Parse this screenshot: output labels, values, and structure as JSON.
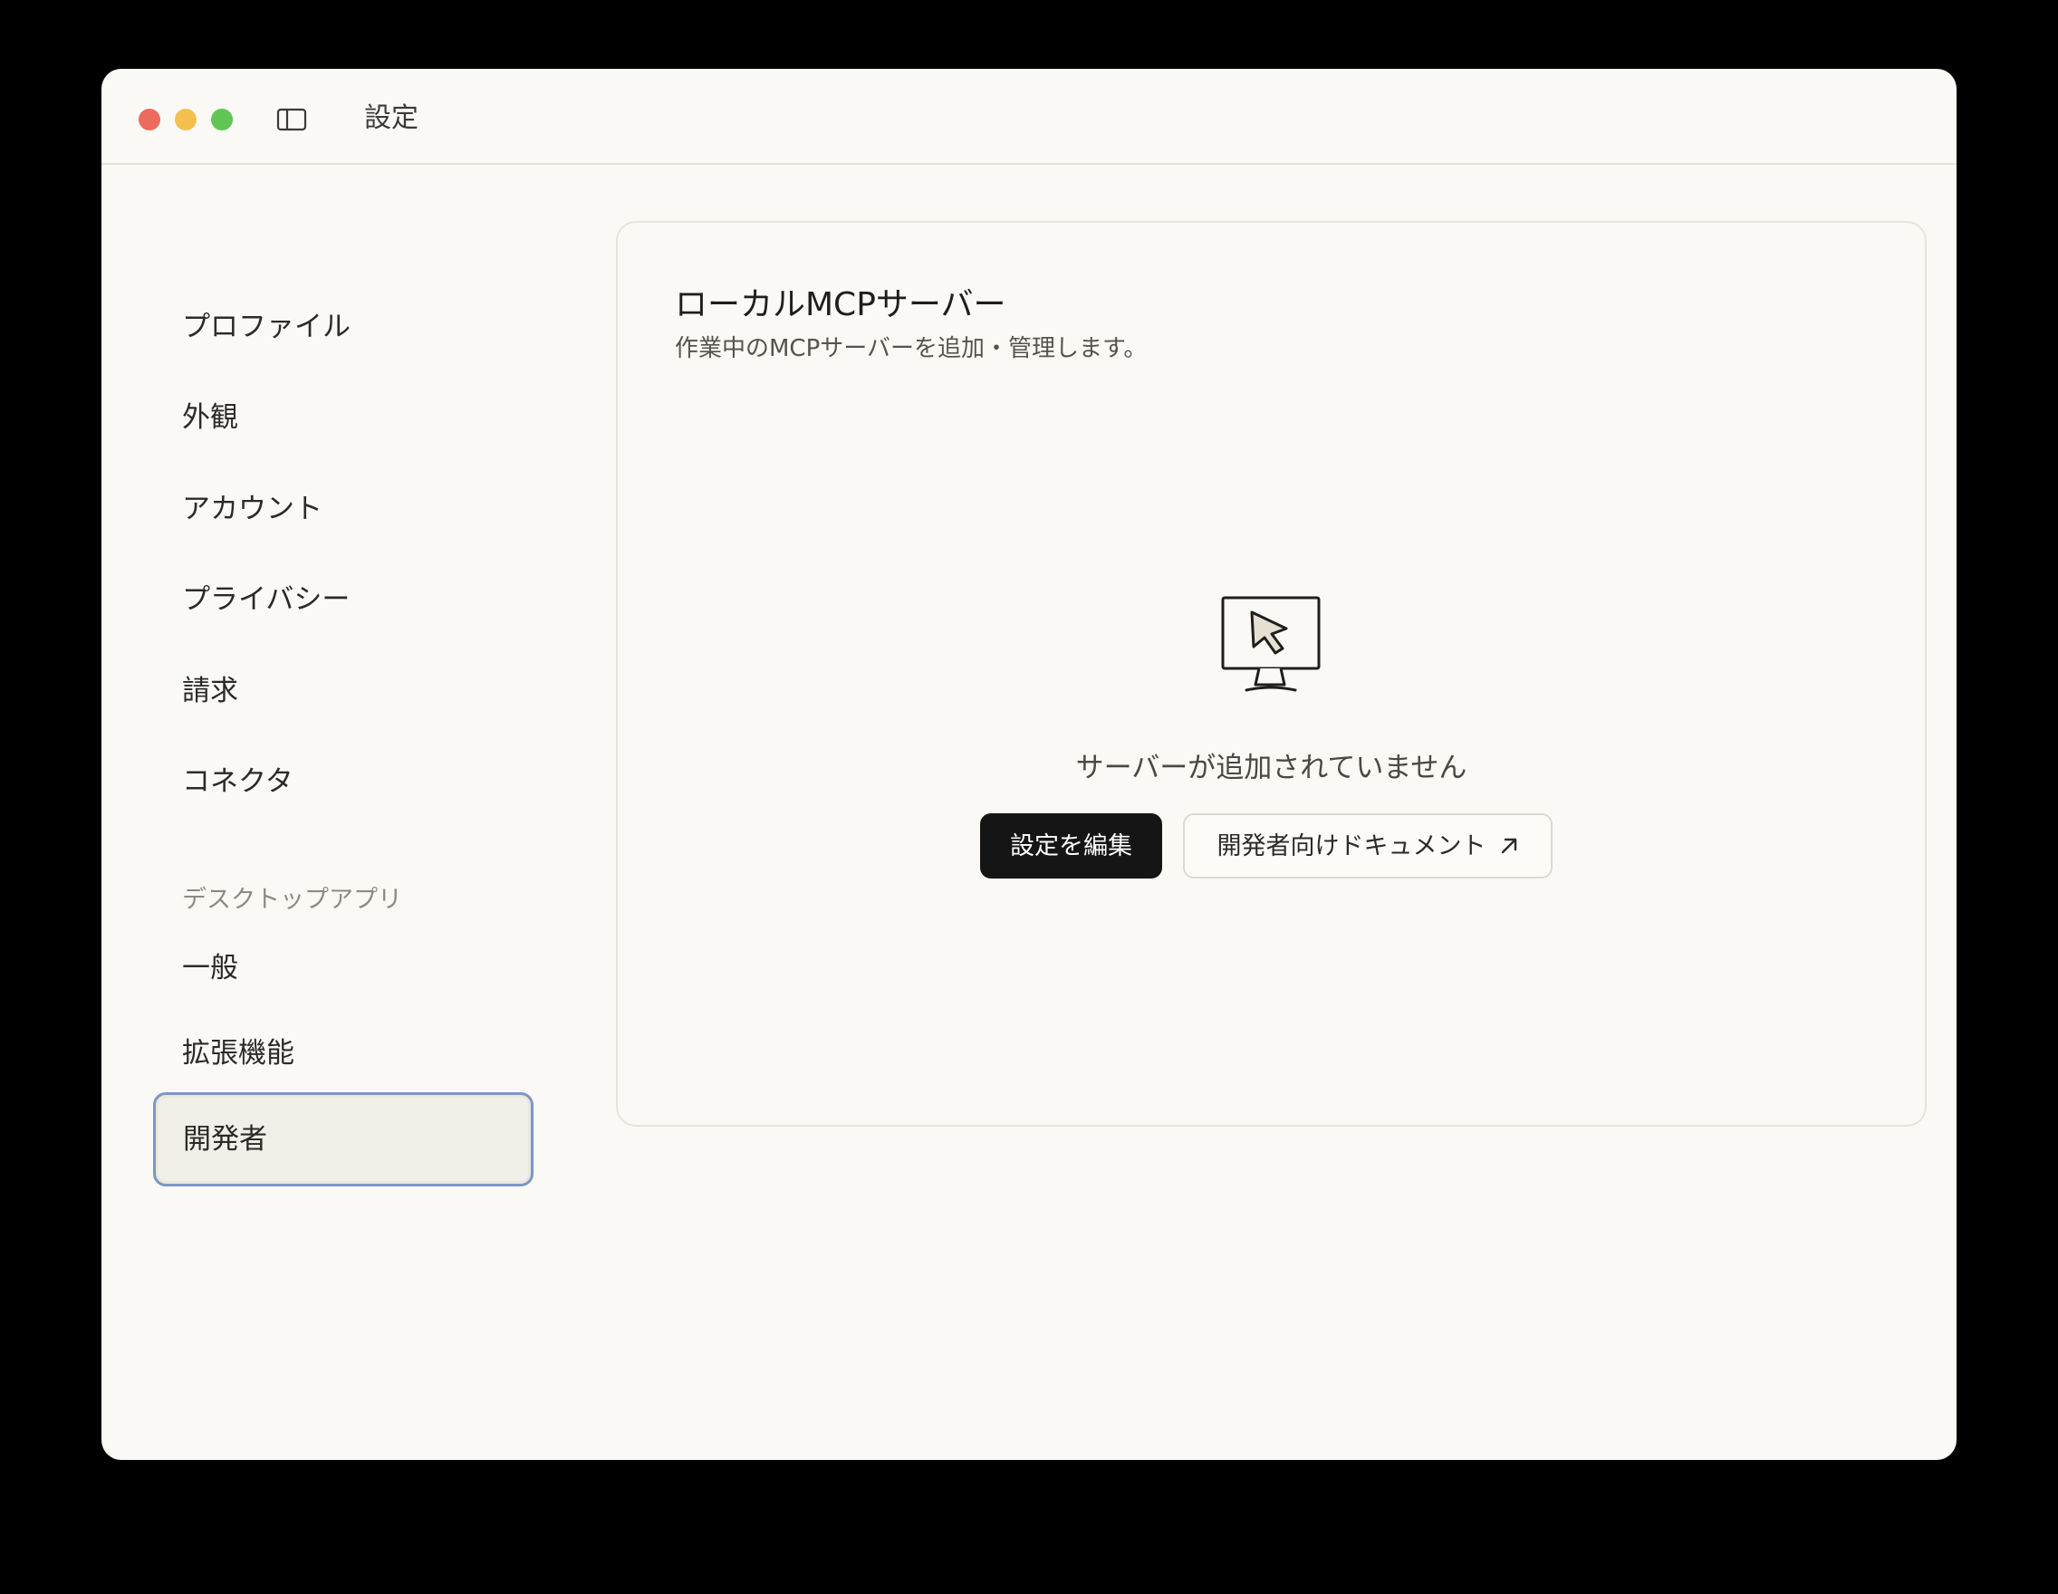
{
  "window": {
    "title": "設定"
  },
  "nav": {
    "items": [
      {
        "label": "プロファイル"
      },
      {
        "label": "外観"
      },
      {
        "label": "アカウント"
      },
      {
        "label": "プライバシー"
      },
      {
        "label": "請求"
      },
      {
        "label": "コネクタ"
      }
    ],
    "desktop_section_label": "デスクトップアプリ",
    "desktop_items": [
      {
        "label": "一般"
      },
      {
        "label": "拡張機能"
      },
      {
        "label": "開発者",
        "active": true
      }
    ]
  },
  "main": {
    "title": "ローカルMCPサーバー",
    "subtitle": "作業中のMCPサーバーを追加・管理します。",
    "empty_state": {
      "icon": "monitor-cursor-icon",
      "text": "サーバーが追加されていません"
    },
    "buttons": {
      "edit_config": "設定を編集",
      "developer_docs": "開発者向けドキュメント"
    }
  },
  "colors": {
    "window_bg": "#faf9f5",
    "primary_button": "#151515",
    "active_outline": "#7b97c4"
  }
}
